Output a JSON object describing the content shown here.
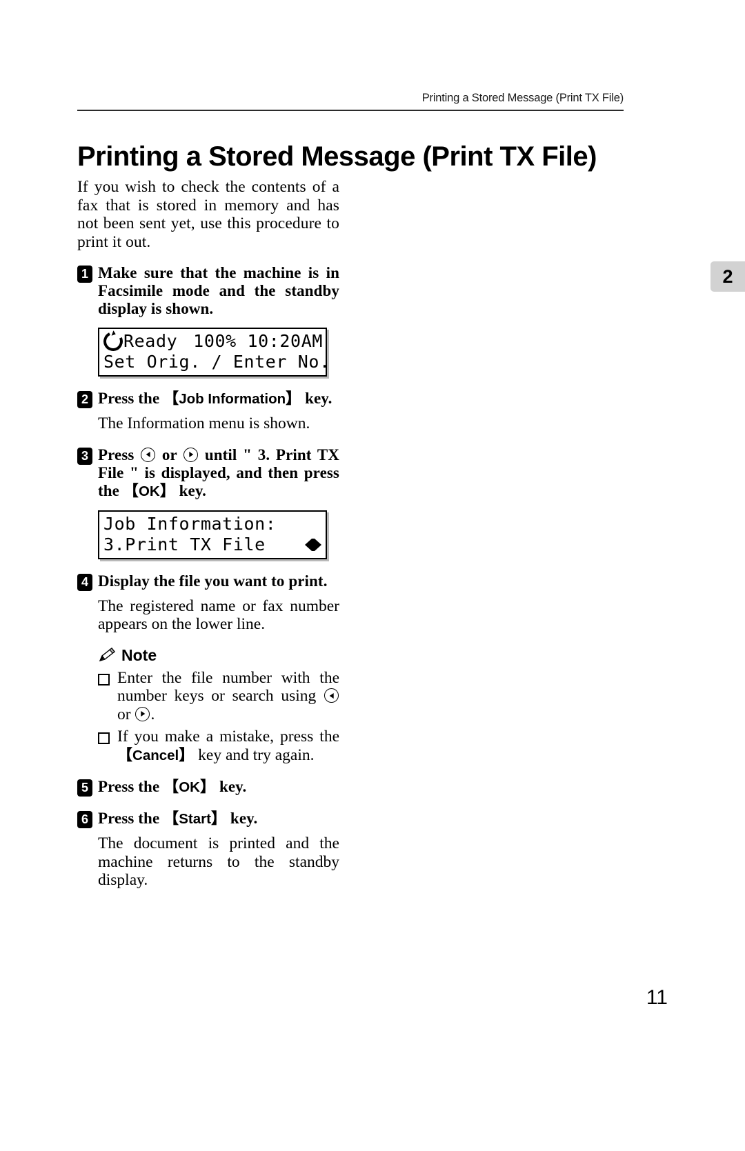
{
  "header": {
    "running_title": "Printing a Stored Message (Print TX File)"
  },
  "chapter_tab": "2",
  "title": "Printing a Stored Message (Print TX File)",
  "intro": "If you wish to check the contents of a fax that is stored in memory and has not been sent yet, use this procedure to print it out.",
  "steps": [
    {
      "number": "1",
      "text": "Make sure that the machine is in Facsimile mode and the standby display is shown."
    },
    {
      "number": "2",
      "text_before": "Press the",
      "key": "Job Information",
      "text_after": "key.",
      "sub": "The Information menu is shown."
    },
    {
      "number": "3",
      "text_a": "Press",
      "text_b": "or",
      "text_c": "until \" 3. Print TX File \" is displayed, and then press the",
      "key": "OK",
      "text_d": "key."
    },
    {
      "number": "4",
      "text": "Display the file you want to print.",
      "sub": "The registered name or fax number appears on the lower line."
    },
    {
      "number": "5",
      "text_before": "Press the",
      "key": "OK",
      "text_after": "key."
    },
    {
      "number": "6",
      "text_before": "Press the",
      "key": "Start",
      "text_after": "key.",
      "sub": "The document is printed and the machine returns to the standby display."
    }
  ],
  "lcd_standby": {
    "line1_status": "Ready",
    "line1_zoom": "100%",
    "line1_time": "10:20AM",
    "line2": "Set Orig. / Enter No.",
    "icon": "cycle-icon"
  },
  "lcd_menu": {
    "line1": "Job Information:",
    "line2": "3.Print TX File",
    "scroll_indicator": "left-right-arrows"
  },
  "note": {
    "label": "Note",
    "icon": "pencil-icon",
    "items": [
      {
        "part_a": "Enter the file number with the number keys or search using",
        "part_b": "or",
        "part_c": "."
      },
      {
        "part_a": "If you make a mistake, press the",
        "key": "Cancel",
        "part_c": "key and try again."
      }
    ]
  },
  "folio": "11",
  "colors": {
    "text": "#000000",
    "rule": "#2b2b2b",
    "tab_bg": "#d2d2d2",
    "lcd_shadow": "#b9b9b9"
  }
}
